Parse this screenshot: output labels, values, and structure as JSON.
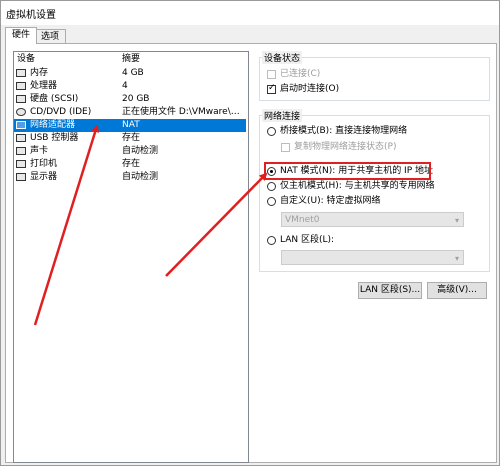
{
  "window": {
    "title": "虚拟机设置"
  },
  "tabs": [
    {
      "label": "硬件"
    },
    {
      "label": "选项"
    }
  ],
  "device_list": {
    "headers": {
      "device": "设备",
      "summary": "摘要"
    },
    "rows": [
      {
        "device": "内存",
        "summary": "4 GB",
        "icon": "memory-icon"
      },
      {
        "device": "处理器",
        "summary": "4",
        "icon": "cpu-icon"
      },
      {
        "device": "硬盘 (SCSI)",
        "summary": "20 GB",
        "icon": "disk-icon"
      },
      {
        "device": "CD/DVD (IDE)",
        "summary": "正在使用文件 D:\\VMware\\Ce...",
        "icon": "cdrom-icon"
      },
      {
        "device": "网络适配器",
        "summary": "NAT",
        "icon": "network-adapter-icon",
        "selected": true
      },
      {
        "device": "USB 控制器",
        "summary": "存在",
        "icon": "usb-icon"
      },
      {
        "device": "声卡",
        "summary": "自动检测",
        "icon": "sound-icon"
      },
      {
        "device": "打印机",
        "summary": "存在",
        "icon": "printer-icon"
      },
      {
        "device": "显示器",
        "summary": "自动检测",
        "icon": "display-icon"
      }
    ]
  },
  "device_status": {
    "label": "设备状态",
    "connected": {
      "label": "已连接(C)",
      "checked": false,
      "disabled": true
    },
    "connect_on_power": {
      "label": "启动时连接(O)",
      "checked": true
    }
  },
  "network_connection": {
    "label": "网络连接",
    "bridged": {
      "label": "桥接模式(B): 直接连接物理网络",
      "checked": false
    },
    "replicate": {
      "label": "复制物理网络连接状态(P)",
      "checked": false,
      "disabled": true
    },
    "nat": {
      "label": "NAT 模式(N): 用于共享主机的 IP 地址",
      "checked": true
    },
    "host_only": {
      "label": "仅主机模式(H): 与主机共享的专用网络",
      "checked": false
    },
    "custom": {
      "label": "自定义(U): 特定虚拟网络",
      "checked": false
    },
    "vmnet_select": {
      "value": "VMnet0"
    },
    "lan_segment": {
      "label": "LAN 区段(L):",
      "checked": false
    },
    "lan_select": {
      "value": ""
    }
  },
  "buttons": {
    "lan_segment": "LAN 区段(S)...",
    "advanced": "高级(V)..."
  },
  "colors": {
    "selection": "#0078d7",
    "annotation": "#e02020"
  }
}
